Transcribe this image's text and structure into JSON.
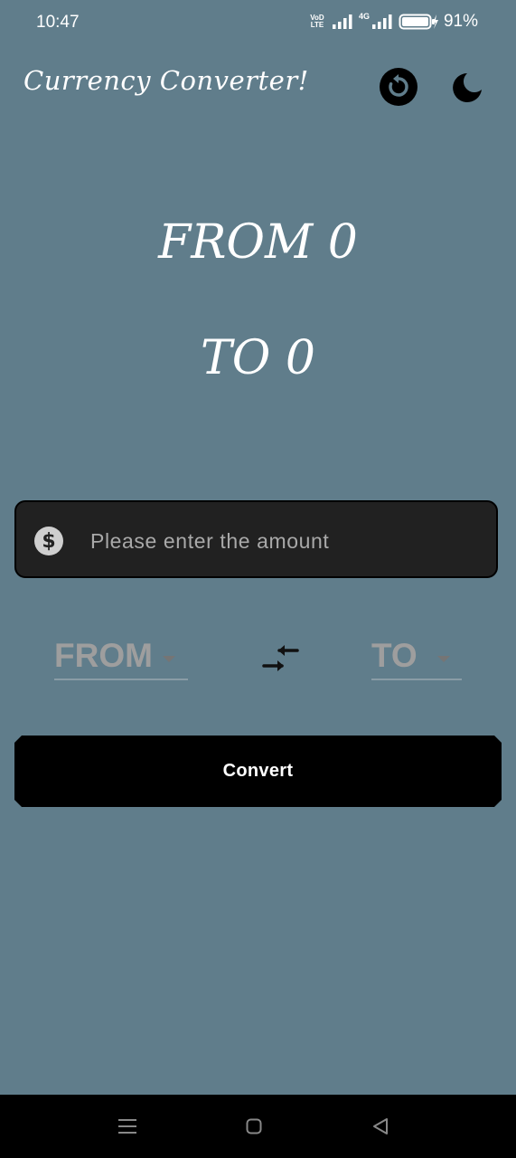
{
  "status": {
    "time": "10:47",
    "volte_top": "VoD",
    "volte_bottom": "LTE",
    "network_tag": "4G",
    "battery": "91%"
  },
  "header": {
    "title": "Currency Converter!",
    "icons": [
      "reset-icon",
      "moon-icon"
    ]
  },
  "result": {
    "from_text": "FROM 0",
    "to_text": "TO 0"
  },
  "amount": {
    "placeholder": "Please enter the amount",
    "value": "",
    "icon": "dollar-icon"
  },
  "selectors": {
    "from_label": "FROM",
    "to_label": "TO",
    "swap_icon": "swap-arrows-icon"
  },
  "actions": {
    "convert_label": "Convert"
  },
  "colors": {
    "background": "#607d8b",
    "input_bg": "#212121",
    "button_bg": "#000000",
    "text": "#ffffff",
    "muted": "#9e9e9e"
  }
}
